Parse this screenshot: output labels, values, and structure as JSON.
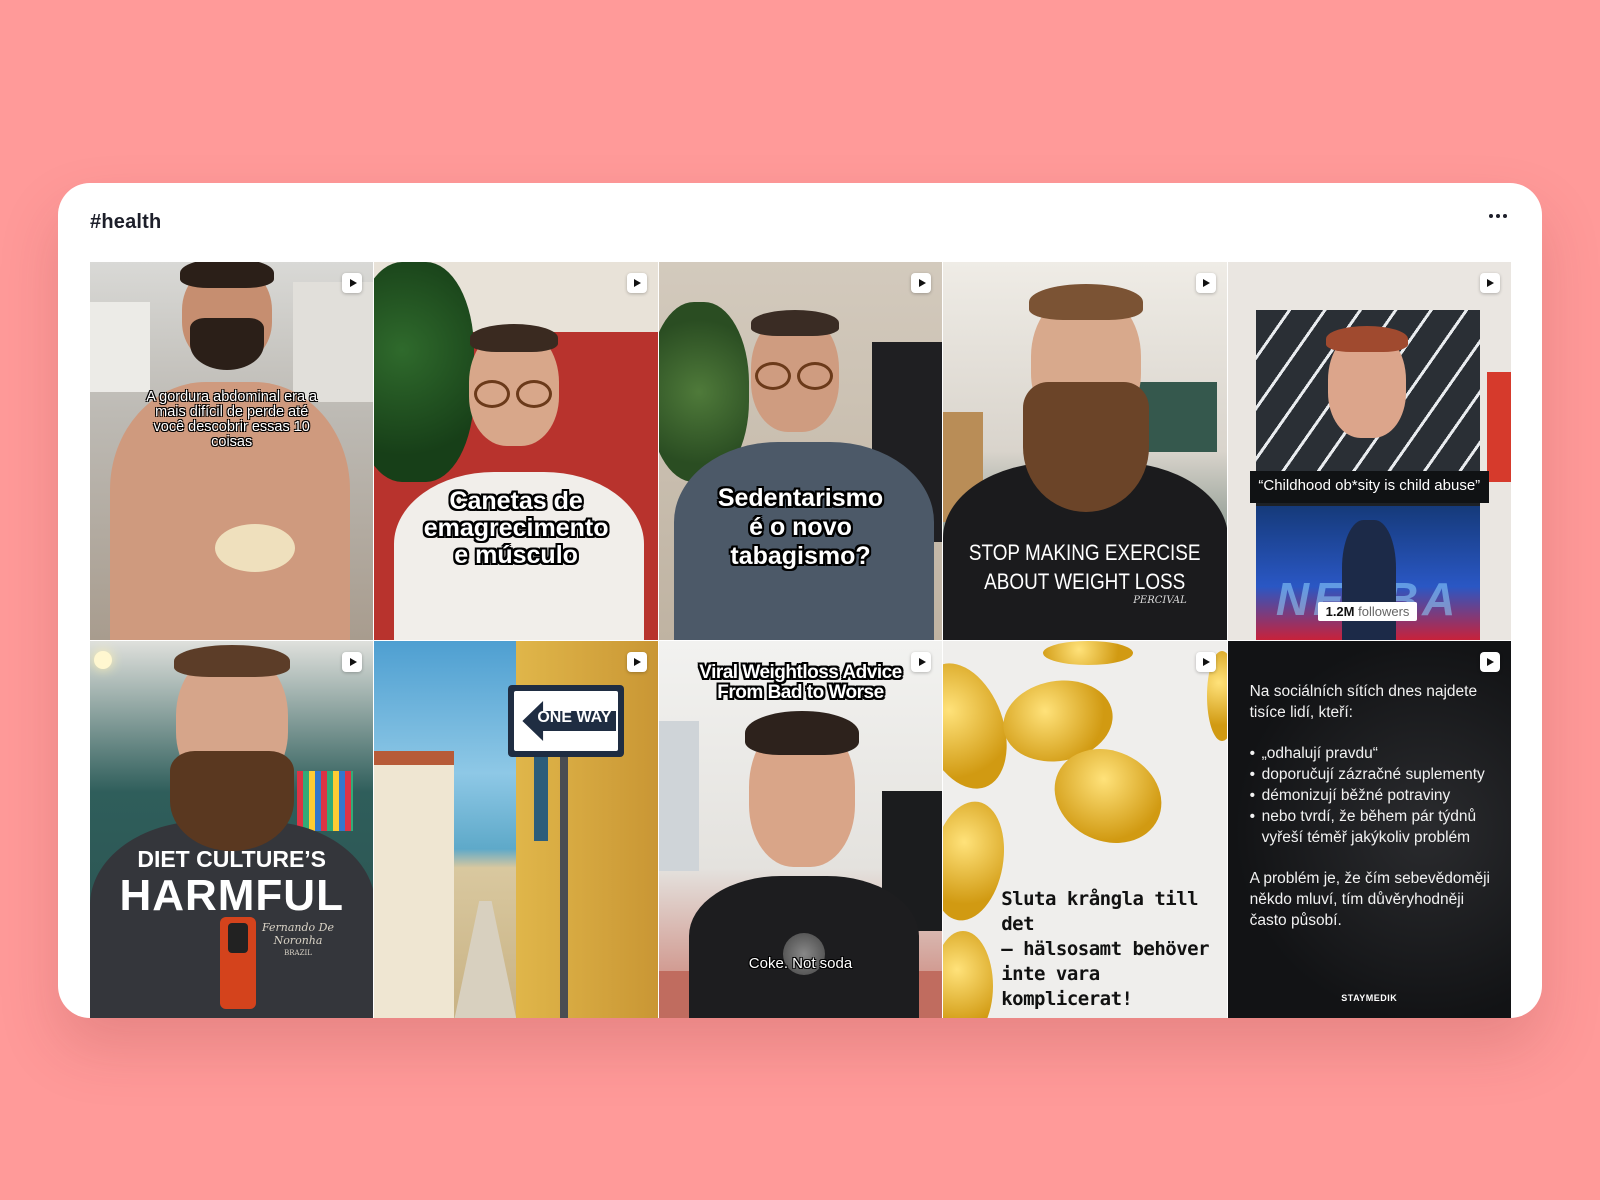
{
  "card": {
    "title": "#health",
    "more_label": "More options"
  },
  "tiles": [
    {
      "caption": "A gordura abdominal era a mais difícil de perde até você descobrir essas 10 coisas"
    },
    {
      "caption_lines": [
        "Canetas de",
        "emagrecimento",
        "e músculo"
      ]
    },
    {
      "caption_lines": [
        "Sedentarismo",
        "é o novo",
        "tabagismo?"
      ]
    },
    {
      "caption_lines": [
        "STOP MAKING EXERCISE",
        "ABOUT WEIGHT LOSS"
      ],
      "shirt_text": "PERCIVAL"
    },
    {
      "quote": "“Childhood ob*sity is child abuse”",
      "followers_count": "1.2M",
      "followers_label": "followers",
      "banner_text": "NERBA"
    },
    {
      "caption_lines": [
        "DIET CULTURE’S",
        "HARMFUL"
      ],
      "shirt_text": "Fernando De Noronha",
      "shirt_sub": "BRAZIL"
    },
    {
      "sign_text": "ONE WAY"
    },
    {
      "caption_lines": [
        "Viral Weightloss Advice",
        "From Bad to Worse"
      ],
      "subtitle": "Coke. Not soda"
    },
    {
      "caption_lines": [
        "Sluta krångla till det",
        "– hälsosamt behöver",
        "inte vara komplicerat!"
      ]
    },
    {
      "intro": "Na sociálních sítích dnes najdete tisíce lidí, kteří:",
      "bullets": [
        "„odhalují pravdu“",
        "doporučují zázračné suplementy",
        "démonizují běžné potraviny",
        "nebo tvrdí, že během pár týdnů vyřeší téměř jakýkoliv problém"
      ],
      "outro": "A problém je, že čím sebevědoměji někdo mluví, tím důvěryhodněji často působí.",
      "brand": "STAYMEDIK"
    }
  ],
  "colors": {
    "background": "#ff9a99",
    "card": "#ffffff",
    "text": "#1d1f2a"
  }
}
